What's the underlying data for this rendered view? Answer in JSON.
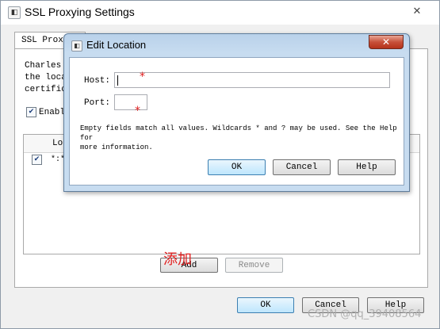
{
  "window": {
    "title": "SSL Proxying Settings",
    "close_label": "✕"
  },
  "tab": {
    "label": "SSL Proxy"
  },
  "description": {
    "line1": "Charles",
    "line2": "the loca",
    "line3": "certific"
  },
  "enable": {
    "label": "Enabl",
    "checked": true
  },
  "locations_table": {
    "column_header": "Loc",
    "rows": [
      {
        "checked": true,
        "value": "*:*"
      }
    ]
  },
  "buttons": {
    "add": "Add",
    "remove": "Remove",
    "ok": "OK",
    "cancel": "Cancel",
    "help": "Help"
  },
  "annotation": {
    "text": "添加",
    "color": "#e02020"
  },
  "watermark": {
    "text": "CSDN @qq_39408564"
  },
  "dialog": {
    "title": "Edit Location",
    "close_label": "✕",
    "host_label": "Host:",
    "host_value": "",
    "port_label": "Port:",
    "port_value": "",
    "required_mark": "*",
    "info_line1": "Empty fields match all values. Wildcards * and ? may be used. See the Help for",
    "info_line2": "more information.",
    "buttons": {
      "ok": "OK",
      "cancel": "Cancel",
      "help": "Help"
    }
  }
}
